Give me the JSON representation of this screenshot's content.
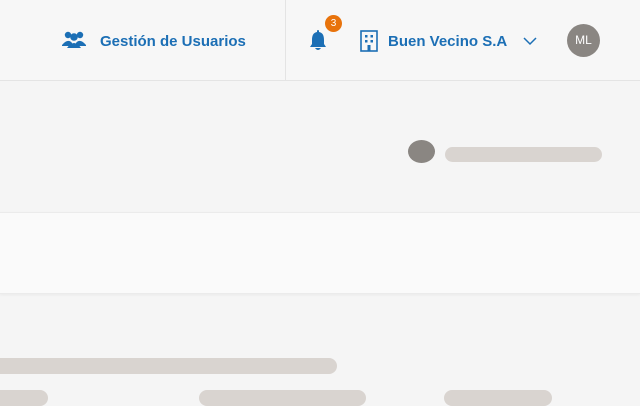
{
  "header": {
    "users_link_label": "Gestión de Usuarios",
    "notifications_count": "3",
    "company_name": "Buen Vecino S.A",
    "avatar_initials": "ML"
  },
  "colors": {
    "accent": "#1c6fb5",
    "badge": "#e8730c",
    "avatar": "#8a8682",
    "skeleton": "#d9d4d0"
  },
  "icons": [
    "users-icon",
    "bell-icon",
    "building-icon",
    "chevron-down-icon"
  ]
}
